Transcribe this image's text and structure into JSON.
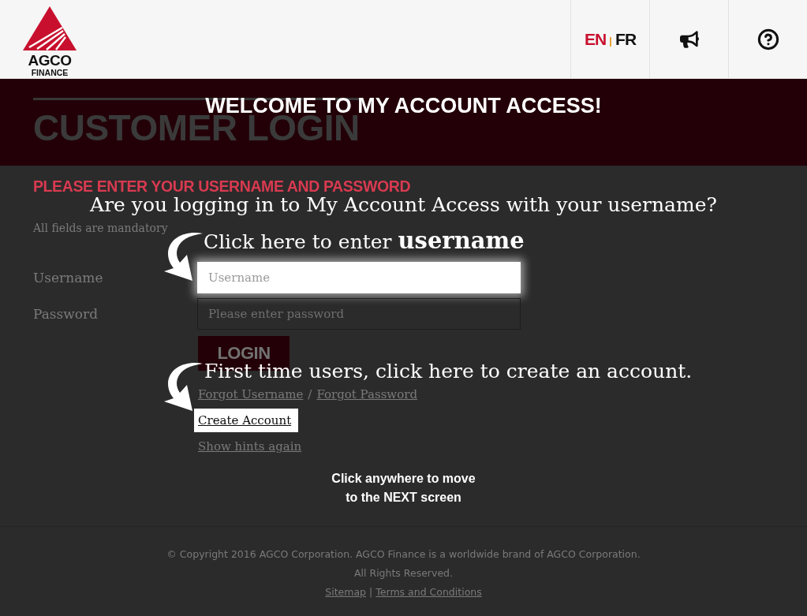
{
  "header": {
    "logo": {
      "name": "AGCO",
      "subtitle": "FINANCE"
    },
    "languages": [
      {
        "label": "EN",
        "selected": true
      },
      {
        "label": "FR",
        "selected": false
      }
    ]
  },
  "banner": {
    "title": "CUSTOMER LOGIN"
  },
  "login_form": {
    "heading": "PLEASE ENTER YOUR USERNAME AND PASSWORD",
    "note": "All fields are mandatory",
    "fields": [
      {
        "label": "Username",
        "placeholder": "Username",
        "highlighted": true
      },
      {
        "label": "Password",
        "placeholder": "Please enter password",
        "highlighted": false
      }
    ],
    "submit_button": "LOGIN",
    "link_rows": [
      {
        "links": [
          "Forgot Username",
          "Forgot Password"
        ],
        "separator": "/",
        "highlighted": false
      },
      {
        "links": [
          "Create Account"
        ],
        "highlighted": true
      },
      {
        "links": [
          "Show hints again"
        ],
        "highlighted": false
      }
    ]
  },
  "footer": {
    "copyright": "© Copyright 2016 AGCO Corporation. AGCO Finance is a worldwide brand of AGCO Corporation.",
    "rights": "All Rights Reserved.",
    "links": [
      "Sitemap",
      "Terms and Conditions"
    ],
    "separator": "|"
  },
  "overlay": {
    "title": "WELCOME TO MY ACCOUNT ACCESS!",
    "question": "Are you logging in to My Account Access with your username?",
    "hints": [
      {
        "text": "Click here to enter **username**"
      },
      {
        "text": "First time users, click here to create an account."
      }
    ],
    "dismiss": "Click anywhere to move\nto the NEXT screen"
  }
}
